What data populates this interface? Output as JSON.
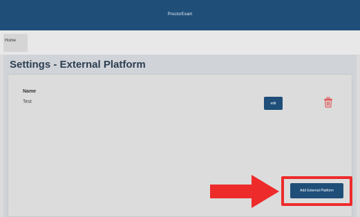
{
  "header": {
    "app_title": "ProctorExam"
  },
  "nav": {
    "home_label": "Home"
  },
  "page": {
    "title": "Settings - External Platform"
  },
  "platforms": {
    "column_header": "Name",
    "rows": [
      {
        "name": "Test",
        "edit_label": "edit",
        "delete_icon": "trash-icon"
      }
    ]
  },
  "actions": {
    "add_label": "Add External Platform"
  },
  "annotation": {
    "arrow_icon": "right-arrow-icon",
    "highlight_color": "#ee2b2b"
  },
  "colors": {
    "brand": "#1f4e79",
    "delete": "#e05a5a"
  }
}
